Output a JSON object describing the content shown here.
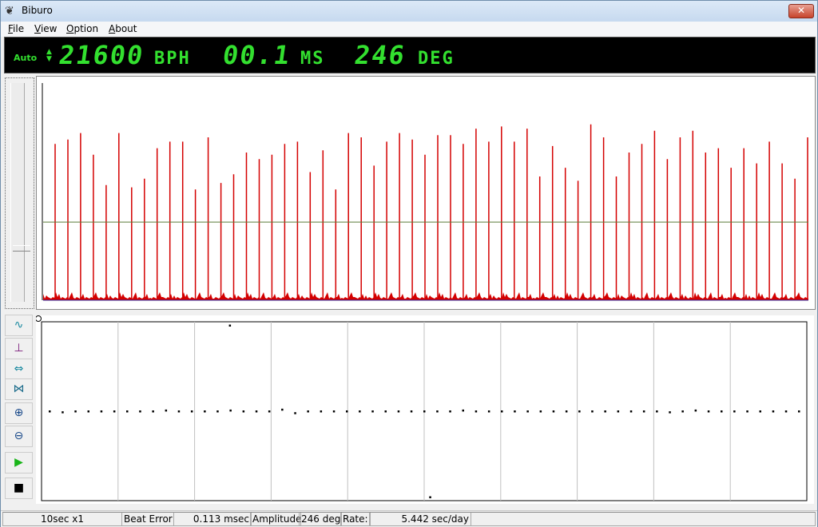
{
  "window": {
    "title": "Biburo",
    "close_label": "✕"
  },
  "menu": [
    {
      "key": "F",
      "rest": "ile"
    },
    {
      "key": "V",
      "rest": "iew"
    },
    {
      "key": "O",
      "rest": "ption"
    },
    {
      "key": "A",
      "rest": "bout"
    }
  ],
  "display": {
    "mode": "Auto",
    "bph_value": "21600",
    "bph_unit": "BPH",
    "ms_value": "00.1",
    "ms_unit": "MS",
    "deg_value": "246",
    "deg_unit": "DEG",
    "color": "#33e02f"
  },
  "waveform": {
    "trace_color": "#d40000",
    "threshold_color": "#5b7d3a",
    "threshold_level": 0.36,
    "peaks": [
      0.72,
      0.74,
      0.77,
      0.67,
      0.53,
      0.77,
      0.52,
      0.56,
      0.7,
      0.73,
      0.73,
      0.51,
      0.75,
      0.54,
      0.58,
      0.68,
      0.65,
      0.67,
      0.72,
      0.73,
      0.59,
      0.69,
      0.51,
      0.77,
      0.75,
      0.62,
      0.73,
      0.77,
      0.74,
      0.67,
      0.76,
      0.76,
      0.72,
      0.79,
      0.73,
      0.8,
      0.73,
      0.79,
      0.57,
      0.71,
      0.61,
      0.55,
      0.81,
      0.75,
      0.57,
      0.68,
      0.72,
      0.78,
      0.65,
      0.75,
      0.78,
      0.68,
      0.7,
      0.61,
      0.7,
      0.63,
      0.73,
      0.63,
      0.56,
      0.75
    ]
  },
  "toolbar": {
    "buttons": [
      {
        "name": "waveform-icon",
        "glyph": "∿",
        "color": "#1a8aa0"
      },
      {
        "name": "level-icon",
        "glyph": "⊥",
        "color": "#7a1a7a"
      },
      {
        "name": "expand-horizontal-icon",
        "glyph": "⇔",
        "color": "#1a8aa0"
      },
      {
        "name": "compress-horizontal-icon",
        "glyph": "⋈",
        "color": "#1a6a8a"
      },
      {
        "name": "zoom-in-icon",
        "glyph": "⊕",
        "color": "#1a4a8a"
      },
      {
        "name": "zoom-out-icon",
        "glyph": "⊖",
        "color": "#1a4a8a"
      },
      {
        "name": "play-icon",
        "glyph": "▶",
        "color": "#1ab51a"
      },
      {
        "name": "stop-icon",
        "glyph": "■",
        "color": "#000000"
      }
    ]
  },
  "scatter": {
    "dot_color": "#000000",
    "grid_color": "#c0c0c0",
    "center_level": 0.5,
    "points": [
      0.5,
      0.495,
      0.5,
      0.5,
      0.5,
      0.5,
      0.5,
      0.5,
      0.5,
      0.505,
      0.5,
      0.5,
      0.5,
      0.5,
      0.505,
      0.5,
      0.5,
      0.5,
      0.51,
      0.49,
      0.5,
      0.5,
      0.5,
      0.5,
      0.5,
      0.5,
      0.5,
      0.5,
      0.5,
      0.5,
      0.5,
      0.5,
      0.505,
      0.5,
      0.5,
      0.5,
      0.5,
      0.5,
      0.5,
      0.5,
      0.5,
      0.5,
      0.5,
      0.5,
      0.5,
      0.5,
      0.5,
      0.5,
      0.495,
      0.5,
      0.505,
      0.5,
      0.5,
      0.5,
      0.5,
      0.5,
      0.5,
      0.5,
      0.5
    ],
    "outliers": [
      {
        "index": 9,
        "level": 0.98
      },
      {
        "index": 19,
        "level": 0.02
      }
    ]
  },
  "status": {
    "scale": "10sec x1",
    "beat_error_label": "Beat Error",
    "beat_error_value": "0.113 msec",
    "amplitude_label": "Amplitude",
    "amplitude_value": "246 deg",
    "rate_label": "Rate:",
    "rate_value": "5.442 sec/day"
  }
}
